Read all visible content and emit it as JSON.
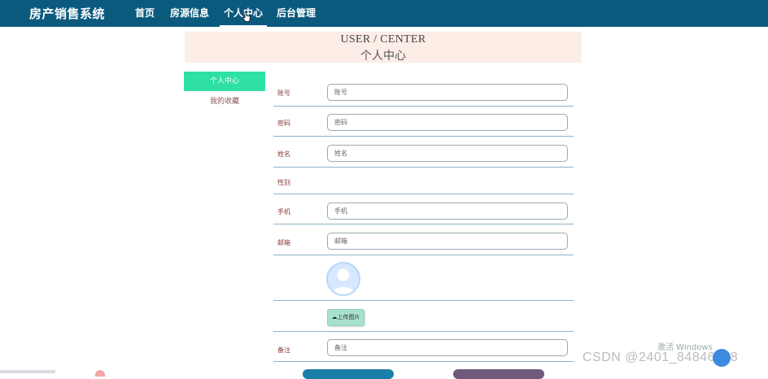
{
  "brand": "房产销售系统",
  "nav": {
    "items": [
      {
        "label": "首页"
      },
      {
        "label": "房源信息"
      },
      {
        "label": "个人中心"
      },
      {
        "label": "后台管理"
      }
    ]
  },
  "banner": {
    "en": "USER / CENTER",
    "cn": "个人中心"
  },
  "sidebar": {
    "items": [
      {
        "label": "个人中心"
      },
      {
        "label": "我的收藏"
      }
    ]
  },
  "form": {
    "account": {
      "label": "账号",
      "placeholder": "账号"
    },
    "password": {
      "label": "密码",
      "placeholder": "密码"
    },
    "name": {
      "label": "姓名",
      "placeholder": "姓名"
    },
    "gender": {
      "label": "性别"
    },
    "phone": {
      "label": "手机",
      "placeholder": "手机"
    },
    "email": {
      "label": "邮箱",
      "placeholder": "邮箱"
    },
    "upload_label": "上传图片",
    "remark": {
      "label": "备注",
      "placeholder": "备注"
    }
  },
  "watermarks": {
    "windows": "激活 Windows",
    "csdn": "CSDN @2401_84846208"
  },
  "colors": {
    "topbar": "#0b5a7e",
    "sidebar_active": "#2ee0a4",
    "banner_bg": "#fcede6",
    "upload_btn": "#a8e2cd",
    "bottom_btn_1": "#1a7fa8",
    "bottom_btn_2": "#6f5a7a"
  }
}
